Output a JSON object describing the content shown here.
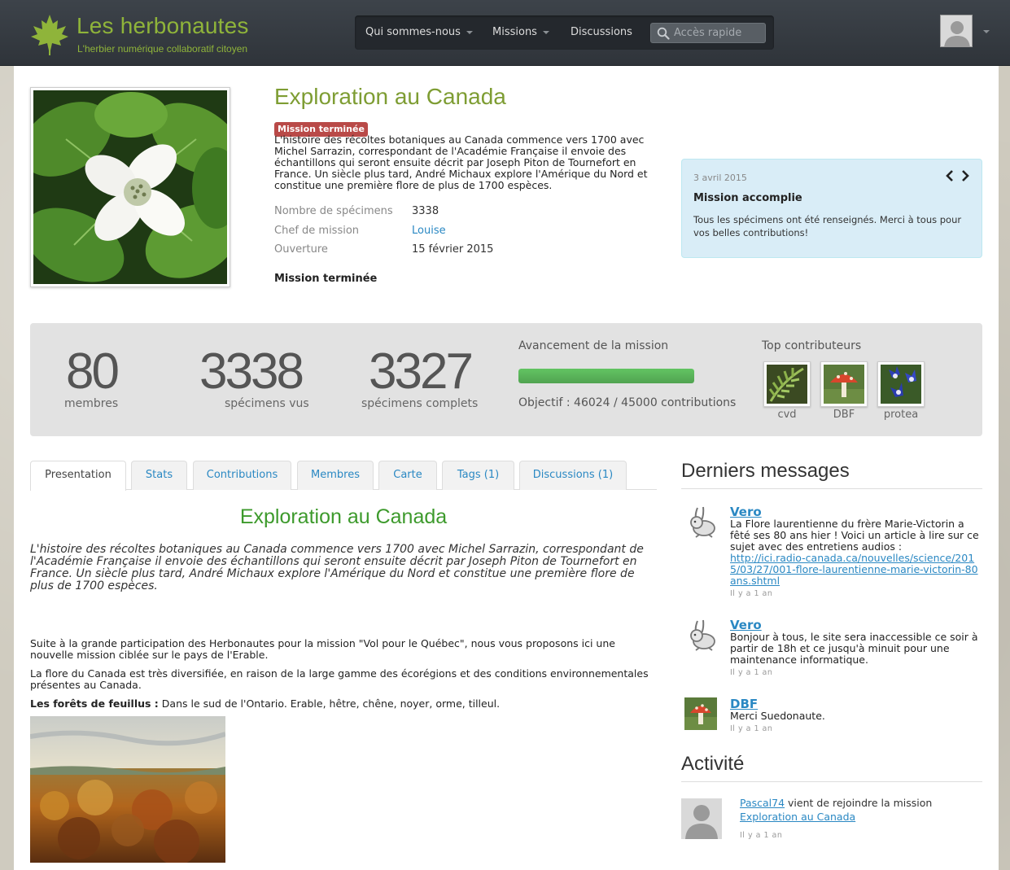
{
  "brand": {
    "title": "Les herbonautes",
    "tagline": "L'herbier numérique collaboratif citoyen"
  },
  "nav": {
    "items": [
      {
        "label": "Qui sommes-nous",
        "dropdown": true
      },
      {
        "label": "Missions",
        "dropdown": true
      },
      {
        "label": "Discussions",
        "dropdown": false
      }
    ],
    "search_placeholder": "Accès rapide"
  },
  "mission": {
    "title": "Exploration au Canada",
    "badge": "Mission terminée",
    "intro": "L'histoire des récoltes botaniques au Canada commence vers 1700 avec Michel Sarrazin, correspondant de l'Académie Française il envoie des échantillons qui seront ensuite décrit par Joseph Piton de Tournefort en France. Un siècle plus tard, André Michaux explore l'Amérique du Nord et constitue une première flore de plus de 1700 espèces.",
    "meta": [
      {
        "label": "Nombre de spécimens",
        "value": "3338",
        "is_link": false
      },
      {
        "label": "Chef de mission",
        "value": "Louise",
        "is_link": true
      },
      {
        "label": "Ouverture",
        "value": "15 février 2015",
        "is_link": false
      }
    ],
    "status": "Mission terminée"
  },
  "news": {
    "date": "3 avril 2015",
    "title": "Mission accomplie",
    "body": "Tous les spécimens ont été renseignés. Merci à tous pour vos belles contributions!"
  },
  "stats": {
    "members": {
      "number": "80",
      "label": "membres"
    },
    "seen": {
      "number": "3338",
      "label": "spécimens vus"
    },
    "complete": {
      "number": "3327",
      "label": "spécimens complets"
    },
    "progress_title": "Avancement de la mission",
    "progress_fraction": 1.0,
    "goal": "Objectif : 46024 / 45000 contributions",
    "top_title": "Top contributeurs",
    "top": [
      "cvd",
      "DBF",
      "protea"
    ]
  },
  "tabs": [
    "Presentation",
    "Stats",
    "Contributions",
    "Membres",
    "Carte",
    "Tags (1)",
    "Discussions (1)"
  ],
  "content": {
    "title": "Exploration au Canada",
    "intro": "L'histoire des récoltes botaniques au Canada commence vers 1700 avec Michel Sarrazin, correspondant de l'Académie Française il envoie des échantillons qui seront ensuite décrit par Joseph Piton de Tournefort en France. Un siècle plus tard, André Michaux explore l'Amérique du Nord et constitue une première flore de plus de 1700 espèces.",
    "p1": "Suite à la grande participation des Herbonautes pour la mission \"Vol pour le Québec\", nous vous proposons ici une nouvelle mission ciblée sur le pays de l'Erable.",
    "p2": "La flore du Canada est très diversifiée, en raison de la large gamme des écorégions et des conditions environnementales présentes au Canada.",
    "p3_bold": "Les forêts de feuillus :",
    "p3_rest": " Dans le sud de l'Ontario. Erable, hêtre, chêne, noyer, orme, tilleul."
  },
  "messages": {
    "heading": "Derniers messages",
    "items": [
      {
        "author": "Vero",
        "text": "La Flore laurentienne du frère Marie-Victorin a fêté ses 80 ans hier ! Voici un article à lire sur ce sujet avec des entretiens audios :",
        "link": "http://ici.radio-canada.ca/nouvelles/science/2015/03/27/001-flore-laurentienne-marie-victorin-80ans.shtml",
        "time": "Il y a 1 an"
      },
      {
        "author": "Vero",
        "text": "Bonjour à tous, le site sera inaccessible ce soir à partir de 18h et ce jusqu'à minuit pour une maintenance informatique.",
        "link": "",
        "time": "Il y a 1 an"
      },
      {
        "author": "DBF",
        "text": "Merci Suedonaute.",
        "link": "",
        "time": "Il y a 1 an"
      }
    ]
  },
  "activity": {
    "heading": "Activité",
    "user": "Pascal74",
    "text": " vient de rejoindre la mission ",
    "mission": "Exploration au Canada",
    "time": "Il y a 1 an"
  },
  "colors": {
    "brand_green": "#8fb43a",
    "title_green": "#7e9d33",
    "badge_red": "#b94a48",
    "link_blue": "#2a88c3",
    "progress_green": "#5eb95e"
  }
}
